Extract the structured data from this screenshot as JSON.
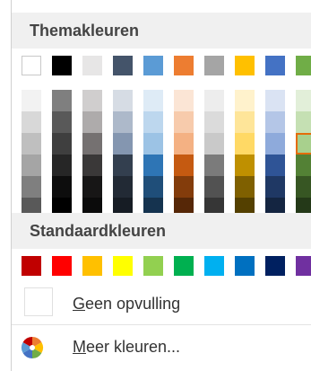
{
  "theme_section": {
    "title": "Themakleuren",
    "top_row": [
      "#ffffff",
      "#000000",
      "#e7e6e6",
      "#44546a",
      "#5b9bd5",
      "#ed7d31",
      "#a5a5a5",
      "#ffc000",
      "#4472c4",
      "#70ad47"
    ],
    "shades": [
      [
        "#f2f2f2",
        "#d8d8d8",
        "#bfbfbf",
        "#a5a5a5",
        "#7f7f7f",
        "#595959"
      ],
      [
        "#7f7f7f",
        "#595959",
        "#3f3f3f",
        "#262626",
        "#0d0d0d",
        "#000000"
      ],
      [
        "#d0cece",
        "#aeabab",
        "#757171",
        "#3a3838",
        "#171616",
        "#0b0b0b"
      ],
      [
        "#d6dce4",
        "#adb9ca",
        "#8496b0",
        "#333f4f",
        "#222a35",
        "#161c24"
      ],
      [
        "#deebf6",
        "#bdd7ee",
        "#9cc3e5",
        "#2e75b5",
        "#1f4e79",
        "#15334f"
      ],
      [
        "#fbe5d5",
        "#f7cbac",
        "#f4b183",
        "#c55a11",
        "#833c0b",
        "#562707"
      ],
      [
        "#ededed",
        "#dbdbdb",
        "#c9c9c9",
        "#7b7b7b",
        "#525252",
        "#363636"
      ],
      [
        "#fff2cc",
        "#fee599",
        "#ffd965",
        "#bf9000",
        "#7f6000",
        "#544000"
      ],
      [
        "#dae3f3",
        "#b4c6e7",
        "#8eaadb",
        "#2f5496",
        "#1f3864",
        "#142541"
      ],
      [
        "#e2efd9",
        "#c5e0b3",
        "#a8d08d",
        "#538135",
        "#375623",
        "#243918"
      ]
    ],
    "selected": {
      "column": 9,
      "row": 2
    }
  },
  "standard_section": {
    "title": "Standaardkleuren",
    "colors": [
      "#c00000",
      "#ff0000",
      "#ffc000",
      "#ffff00",
      "#92d050",
      "#00b050",
      "#00b0f0",
      "#0070c0",
      "#002060",
      "#7030a0"
    ]
  },
  "menu": {
    "no_fill": {
      "underline_char": "G",
      "rest": "een opvulling"
    },
    "more_colors": {
      "underline_char": "M",
      "rest": "eer kleuren..."
    }
  },
  "icons": {
    "no_fill": "empty-swatch-icon",
    "more_colors": "color-palette-icon"
  }
}
